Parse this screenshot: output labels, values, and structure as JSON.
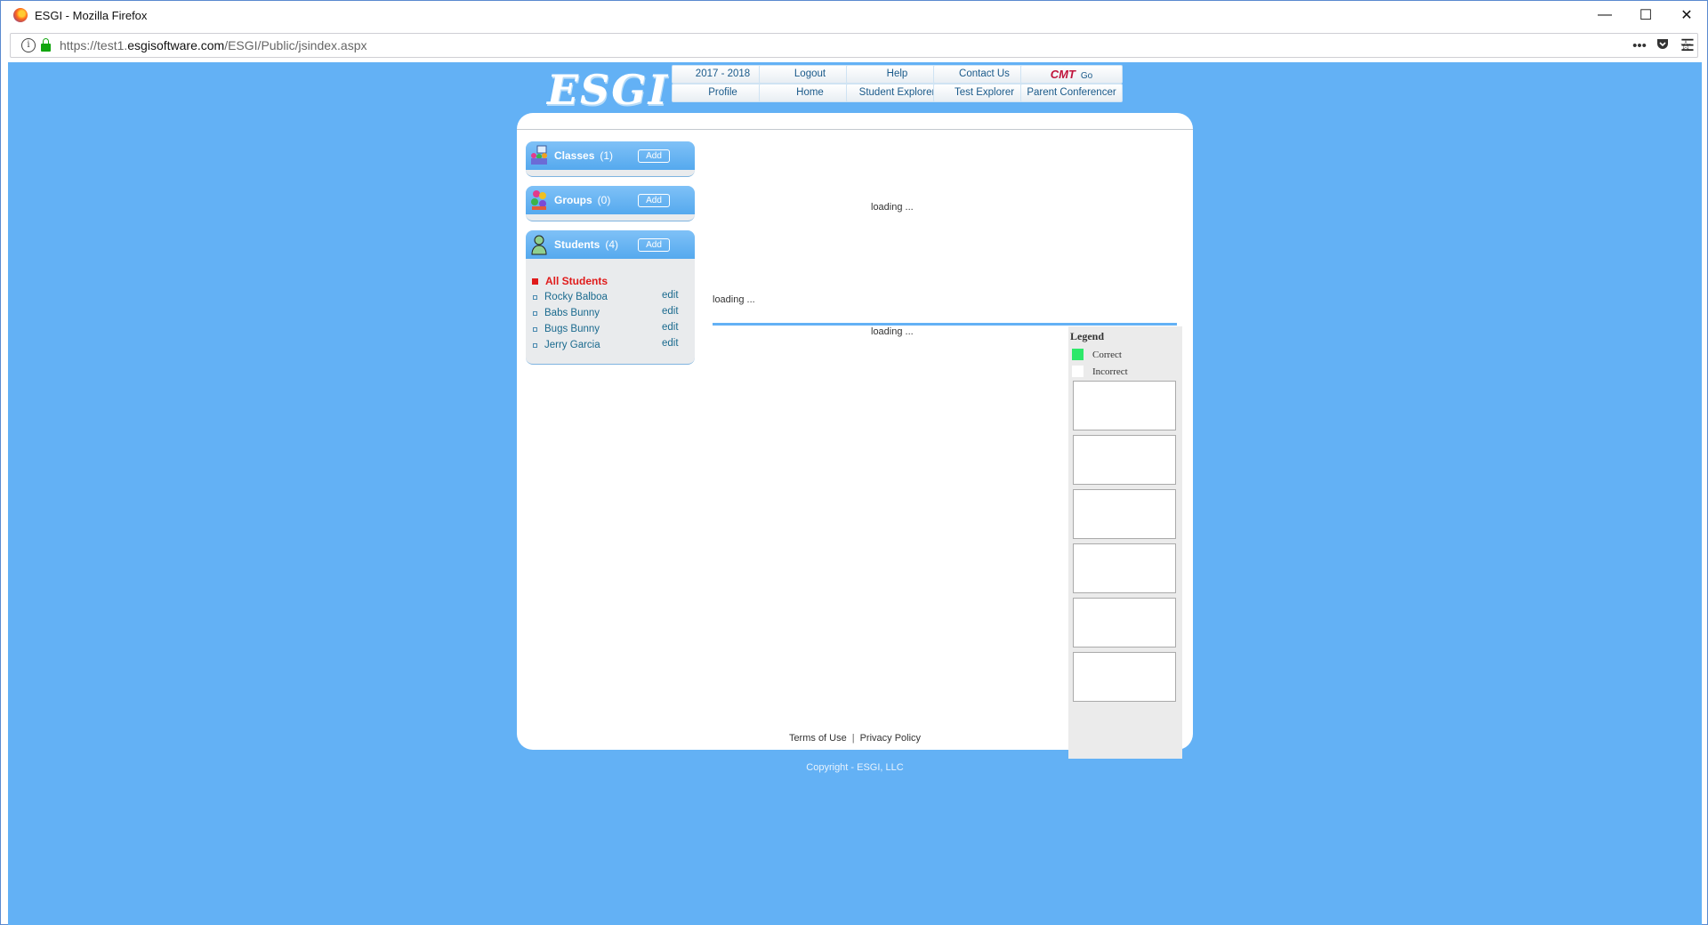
{
  "browser": {
    "window_title": "ESGI - Mozilla Firefox",
    "url_prefix": "https://test1.",
    "url_domain": "esgisoftware.com",
    "url_path": "/ESGI/Public/jsindex.aspx",
    "controls": {
      "minimize": "—",
      "maximize": "☐",
      "close": "✕"
    },
    "page_actions": "•••",
    "menu": "☰"
  },
  "header": {
    "logo": "ESGI",
    "nav_top": [
      "2017 - 2018",
      "Logout",
      "Help",
      "Contact Us"
    ],
    "cmt_label": "CMT",
    "cmt_go": "Go",
    "nav_bottom": [
      "Profile",
      "Home",
      "Student Explorer",
      "Test Explorer",
      "Parent Conferencer"
    ]
  },
  "sidebar": {
    "classes": {
      "title": "Classes",
      "count": "(1)",
      "add": "Add"
    },
    "groups": {
      "title": "Groups",
      "count": "(0)",
      "add": "Add"
    },
    "students": {
      "title": "Students",
      "count": "(4)",
      "add": "Add",
      "all_label": "All Students",
      "items": [
        {
          "name": "Rocky Balboa",
          "action": "edit"
        },
        {
          "name": "Babs Bunny",
          "action": "edit"
        },
        {
          "name": "Bugs Bunny",
          "action": "edit"
        },
        {
          "name": "Jerry Garcia",
          "action": "edit"
        }
      ]
    }
  },
  "main": {
    "loading_top": "loading ...",
    "loading_mid": "loading ...",
    "loading_bottom": "loading ..."
  },
  "legend": {
    "title": "Legend",
    "correct": "Correct",
    "incorrect": "Incorrect",
    "correct_color": "#2ee86a",
    "incorrect_color": "#ffffff"
  },
  "footer": {
    "terms": "Terms of Use",
    "separator": "|",
    "privacy": "Privacy Policy",
    "copyright": "Copyright - ESGI, LLC"
  },
  "colors": {
    "page_background": "#63b1f5",
    "panel_header": "#55a9ee",
    "all_students": "#e01b1b"
  }
}
